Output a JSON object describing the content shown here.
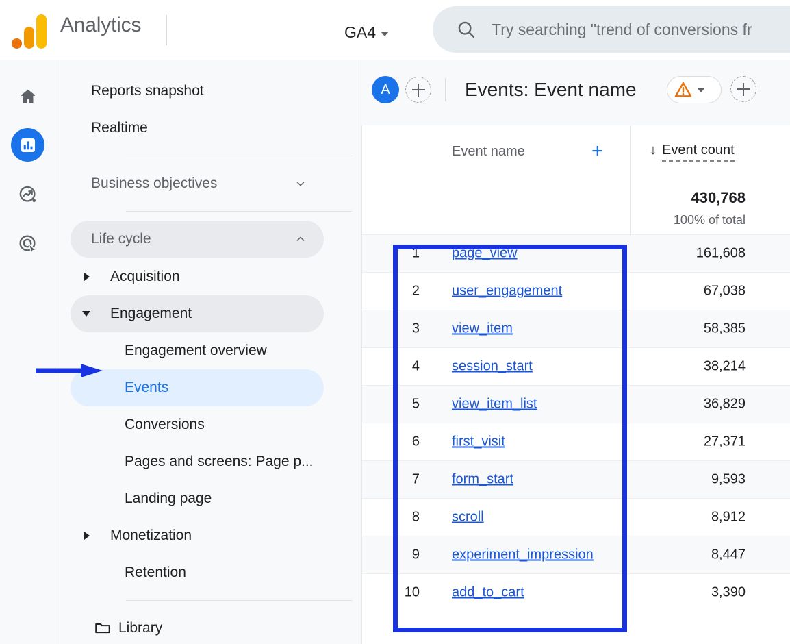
{
  "topbar": {
    "brand": "Analytics",
    "logo_colors": {
      "dot": "#e8710a",
      "mid": "#f29900",
      "tall": "#fbbc04"
    },
    "property_selector": "GA4",
    "search_placeholder": "Try searching \"trend of conversions fr"
  },
  "rail": {
    "items": [
      {
        "name": "home-icon",
        "label": "Home",
        "active": false
      },
      {
        "name": "reports-icon",
        "label": "Reports",
        "active": true
      },
      {
        "name": "explore-icon",
        "label": "Explore",
        "active": false
      },
      {
        "name": "advertising-icon",
        "label": "Advertising",
        "active": false
      }
    ],
    "active_color": "#1a73e8"
  },
  "sidebar": {
    "items": [
      {
        "label": "Reports snapshot",
        "type": "item"
      },
      {
        "label": "Realtime",
        "type": "item"
      },
      {
        "type": "separator"
      },
      {
        "label": "Business objectives",
        "type": "group",
        "expanded": false
      },
      {
        "type": "separator"
      },
      {
        "label": "Life cycle",
        "type": "group",
        "expanded": true
      },
      {
        "label": "Acquisition",
        "type": "collapsible",
        "expanded": false
      },
      {
        "label": "Engagement",
        "type": "collapsible",
        "expanded": true
      },
      {
        "label": "Engagement overview",
        "type": "sub"
      },
      {
        "label": "Events",
        "type": "sub",
        "selected": true
      },
      {
        "label": "Conversions",
        "type": "sub"
      },
      {
        "label": "Pages and screens: Page p...",
        "type": "sub"
      },
      {
        "label": "Landing page",
        "type": "sub"
      },
      {
        "label": "Monetization",
        "type": "collapsible",
        "expanded": false
      },
      {
        "label": "Retention",
        "type": "sub"
      },
      {
        "type": "separator"
      },
      {
        "label": "Library",
        "type": "item-icon",
        "icon": "folder-icon"
      }
    ],
    "selected_color": "#1a73e8",
    "selected_bg": "#e1efff"
  },
  "report": {
    "avatar_initial": "A",
    "add_comparison_label": "+",
    "title": "Events: Event name",
    "warning_icon": "warning-triangle-icon",
    "warning_color": "#e8710a",
    "add_dimension_label": "+"
  },
  "table": {
    "col_dimension": "Event name",
    "add_dimension_plus": "+",
    "sort_arrow": "↓",
    "col_metric": "Event count",
    "total_value": "430,768",
    "total_note": "100% of total",
    "rows": [
      {
        "rank": "1",
        "event": "page_view",
        "count": "161,608"
      },
      {
        "rank": "2",
        "event": "user_engagement",
        "count": "67,038"
      },
      {
        "rank": "3",
        "event": "view_item",
        "count": "58,385"
      },
      {
        "rank": "4",
        "event": "session_start",
        "count": "38,214"
      },
      {
        "rank": "5",
        "event": "view_item_list",
        "count": "36,829"
      },
      {
        "rank": "6",
        "event": "first_visit",
        "count": "27,371"
      },
      {
        "rank": "7",
        "event": "form_start",
        "count": "9,593"
      },
      {
        "rank": "8",
        "event": "scroll",
        "count": "8,912"
      },
      {
        "rank": "9",
        "event": "experiment_impression",
        "count": "8,447"
      },
      {
        "rank": "10",
        "event": "add_to_cart",
        "count": "3,390"
      }
    ]
  },
  "annotations": {
    "highlight_color": "#1a33e0",
    "box_target": "events-table-rows",
    "arrow_target": "sidebar-item-events"
  }
}
